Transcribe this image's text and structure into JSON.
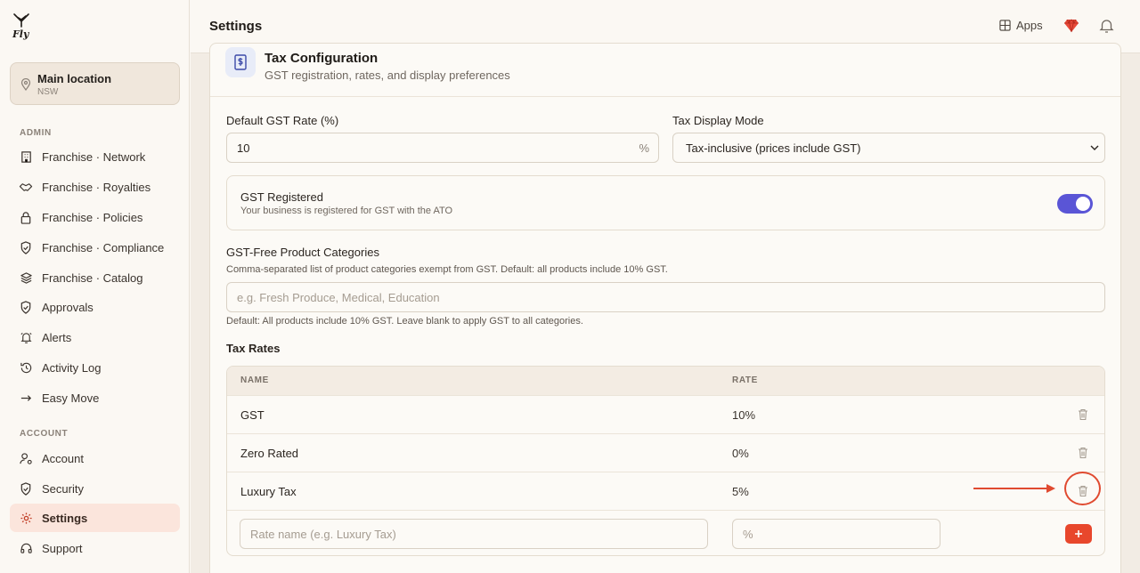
{
  "brand": {
    "logo_text": "Fly"
  },
  "location": {
    "name": "Main location",
    "sub": "NSW"
  },
  "sidebar": {
    "admin_label": "ADMIN",
    "admin_items": [
      {
        "label": "Franchise · Network",
        "icon": "building-icon"
      },
      {
        "label": "Franchise · Royalties",
        "icon": "handshake-icon"
      },
      {
        "label": "Franchise · Policies",
        "icon": "lock-icon"
      },
      {
        "label": "Franchise · Compliance",
        "icon": "shield-check-icon"
      },
      {
        "label": "Franchise · Catalog",
        "icon": "layers-icon"
      },
      {
        "label": "Approvals",
        "icon": "shield-check-icon"
      },
      {
        "label": "Alerts",
        "icon": "bell-ring-icon"
      },
      {
        "label": "Activity Log",
        "icon": "history-icon"
      },
      {
        "label": "Easy Move",
        "icon": "arrows-icon"
      }
    ],
    "account_label": "ACCOUNT",
    "account_items": [
      {
        "label": "Account",
        "icon": "user-cog-icon"
      },
      {
        "label": "Security",
        "icon": "shield-icon"
      },
      {
        "label": "Settings",
        "icon": "gear-icon",
        "active": true
      },
      {
        "label": "Support",
        "icon": "headset-icon"
      }
    ]
  },
  "header": {
    "title": "Settings",
    "apps_label": "Apps"
  },
  "tax": {
    "title": "Tax Configuration",
    "subtitle": "GST registration, rates, and display preferences",
    "gst_rate_label": "Default GST Rate (%)",
    "gst_rate_value": "10",
    "gst_rate_suffix": "%",
    "display_mode_label": "Tax Display Mode",
    "display_mode_value": "Tax-inclusive (prices include GST)",
    "registered_title": "GST Registered",
    "registered_desc": "Your business is registered for GST with the ATO",
    "registered_on": true,
    "free_categories_label": "GST-Free Product Categories",
    "free_categories_desc": "Comma-separated list of product categories exempt from GST. Default: all products include 10% GST.",
    "free_categories_placeholder": "e.g. Fresh Produce, Medical, Education",
    "free_categories_help": "Default: All products include 10% GST. Leave blank to apply GST to all categories.",
    "rates_label": "Tax Rates",
    "columns": {
      "name": "NAME",
      "rate": "RATE"
    },
    "rates": [
      {
        "name": "GST",
        "rate": "10%"
      },
      {
        "name": "Zero Rated",
        "rate": "0%"
      },
      {
        "name": "Luxury Tax",
        "rate": "5%"
      }
    ],
    "new_name_placeholder": "Rate name (e.g. Luxury Tax)",
    "new_rate_placeholder": "%"
  },
  "colors": {
    "accent": "#e8472c",
    "toggle": "#5a55d6",
    "active_nav_bg": "#fbe5dc"
  }
}
